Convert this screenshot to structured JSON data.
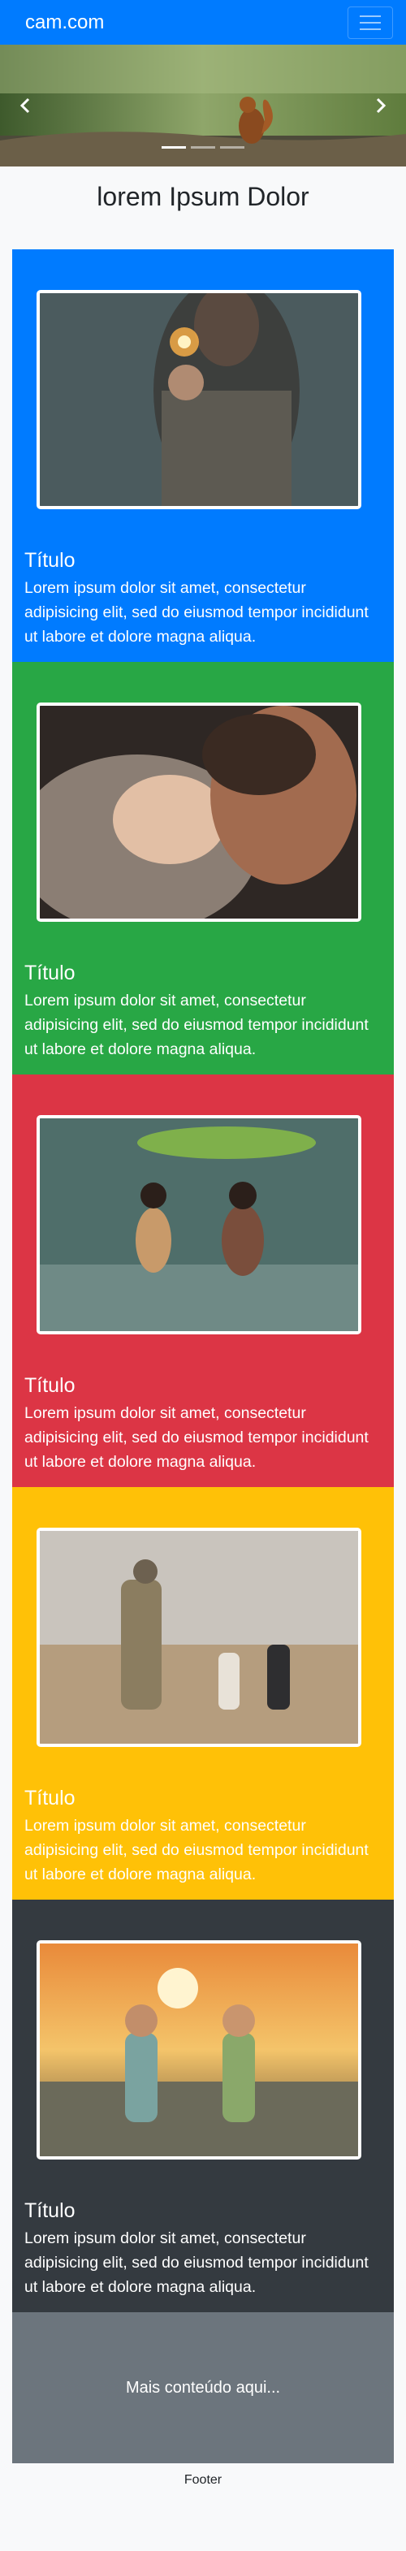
{
  "nav": {
    "brand": "cam.com",
    "menu_icon": "hamburger-icon"
  },
  "carousel": {
    "prev_icon": "chevron-left-icon",
    "next_icon": "chevron-right-icon",
    "slide_count": 3,
    "active_slide": 1
  },
  "page": {
    "title": "lorem Ipsum Dolor"
  },
  "cards": [
    {
      "title": "Título",
      "text": "Lorem ipsum dolor sit amet, consectetur adipisicing elit, sed do eiusmod tempor incididunt ut labore et dolore magna aliqua.",
      "color": "#007bff"
    },
    {
      "title": "Título",
      "text": "Lorem ipsum dolor sit amet, consectetur adipisicing elit, sed do eiusmod tempor incididunt ut labore et dolore magna aliqua.",
      "color": "#28a745"
    },
    {
      "title": "Título",
      "text": "Lorem ipsum dolor sit amet, consectetur adipisicing elit, sed do eiusmod tempor incididunt ut labore et dolore magna aliqua.",
      "color": "#dc3545"
    },
    {
      "title": "Título",
      "text": "Lorem ipsum dolor sit amet, consectetur adipisicing elit, sed do eiusmod tempor incididunt ut labore et dolore magna aliqua.",
      "color": "#ffc107"
    },
    {
      "title": "Título",
      "text": "Lorem ipsum dolor sit amet, consectetur adipisicing elit, sed do eiusmod tempor incididunt ut labore et dolore magna aliqua.",
      "color": "#343a40"
    }
  ],
  "more": {
    "text": "Mais conteúdo aqui..."
  },
  "footer": {
    "text": "Footer"
  }
}
